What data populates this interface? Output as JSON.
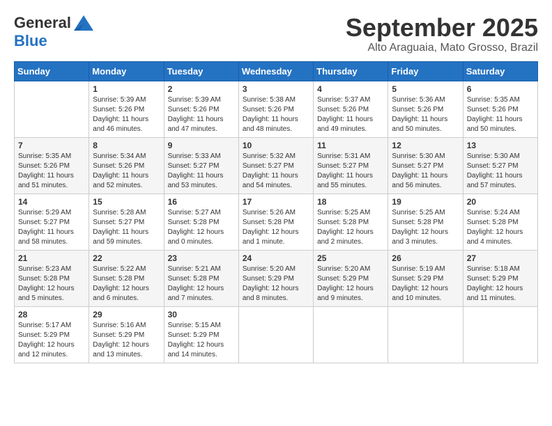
{
  "header": {
    "logo_general": "General",
    "logo_blue": "Blue",
    "month_title": "September 2025",
    "location": "Alto Araguaia, Mato Grosso, Brazil"
  },
  "days_of_week": [
    "Sunday",
    "Monday",
    "Tuesday",
    "Wednesday",
    "Thursday",
    "Friday",
    "Saturday"
  ],
  "weeks": [
    [
      {
        "day": "",
        "info": ""
      },
      {
        "day": "1",
        "info": "Sunrise: 5:39 AM\nSunset: 5:26 PM\nDaylight: 11 hours\nand 46 minutes."
      },
      {
        "day": "2",
        "info": "Sunrise: 5:39 AM\nSunset: 5:26 PM\nDaylight: 11 hours\nand 47 minutes."
      },
      {
        "day": "3",
        "info": "Sunrise: 5:38 AM\nSunset: 5:26 PM\nDaylight: 11 hours\nand 48 minutes."
      },
      {
        "day": "4",
        "info": "Sunrise: 5:37 AM\nSunset: 5:26 PM\nDaylight: 11 hours\nand 49 minutes."
      },
      {
        "day": "5",
        "info": "Sunrise: 5:36 AM\nSunset: 5:26 PM\nDaylight: 11 hours\nand 50 minutes."
      },
      {
        "day": "6",
        "info": "Sunrise: 5:35 AM\nSunset: 5:26 PM\nDaylight: 11 hours\nand 50 minutes."
      }
    ],
    [
      {
        "day": "7",
        "info": "Sunrise: 5:35 AM\nSunset: 5:26 PM\nDaylight: 11 hours\nand 51 minutes."
      },
      {
        "day": "8",
        "info": "Sunrise: 5:34 AM\nSunset: 5:26 PM\nDaylight: 11 hours\nand 52 minutes."
      },
      {
        "day": "9",
        "info": "Sunrise: 5:33 AM\nSunset: 5:27 PM\nDaylight: 11 hours\nand 53 minutes."
      },
      {
        "day": "10",
        "info": "Sunrise: 5:32 AM\nSunset: 5:27 PM\nDaylight: 11 hours\nand 54 minutes."
      },
      {
        "day": "11",
        "info": "Sunrise: 5:31 AM\nSunset: 5:27 PM\nDaylight: 11 hours\nand 55 minutes."
      },
      {
        "day": "12",
        "info": "Sunrise: 5:30 AM\nSunset: 5:27 PM\nDaylight: 11 hours\nand 56 minutes."
      },
      {
        "day": "13",
        "info": "Sunrise: 5:30 AM\nSunset: 5:27 PM\nDaylight: 11 hours\nand 57 minutes."
      }
    ],
    [
      {
        "day": "14",
        "info": "Sunrise: 5:29 AM\nSunset: 5:27 PM\nDaylight: 11 hours\nand 58 minutes."
      },
      {
        "day": "15",
        "info": "Sunrise: 5:28 AM\nSunset: 5:27 PM\nDaylight: 11 hours\nand 59 minutes."
      },
      {
        "day": "16",
        "info": "Sunrise: 5:27 AM\nSunset: 5:28 PM\nDaylight: 12 hours\nand 0 minutes."
      },
      {
        "day": "17",
        "info": "Sunrise: 5:26 AM\nSunset: 5:28 PM\nDaylight: 12 hours\nand 1 minute."
      },
      {
        "day": "18",
        "info": "Sunrise: 5:25 AM\nSunset: 5:28 PM\nDaylight: 12 hours\nand 2 minutes."
      },
      {
        "day": "19",
        "info": "Sunrise: 5:25 AM\nSunset: 5:28 PM\nDaylight: 12 hours\nand 3 minutes."
      },
      {
        "day": "20",
        "info": "Sunrise: 5:24 AM\nSunset: 5:28 PM\nDaylight: 12 hours\nand 4 minutes."
      }
    ],
    [
      {
        "day": "21",
        "info": "Sunrise: 5:23 AM\nSunset: 5:28 PM\nDaylight: 12 hours\nand 5 minutes."
      },
      {
        "day": "22",
        "info": "Sunrise: 5:22 AM\nSunset: 5:28 PM\nDaylight: 12 hours\nand 6 minutes."
      },
      {
        "day": "23",
        "info": "Sunrise: 5:21 AM\nSunset: 5:28 PM\nDaylight: 12 hours\nand 7 minutes."
      },
      {
        "day": "24",
        "info": "Sunrise: 5:20 AM\nSunset: 5:29 PM\nDaylight: 12 hours\nand 8 minutes."
      },
      {
        "day": "25",
        "info": "Sunrise: 5:20 AM\nSunset: 5:29 PM\nDaylight: 12 hours\nand 9 minutes."
      },
      {
        "day": "26",
        "info": "Sunrise: 5:19 AM\nSunset: 5:29 PM\nDaylight: 12 hours\nand 10 minutes."
      },
      {
        "day": "27",
        "info": "Sunrise: 5:18 AM\nSunset: 5:29 PM\nDaylight: 12 hours\nand 11 minutes."
      }
    ],
    [
      {
        "day": "28",
        "info": "Sunrise: 5:17 AM\nSunset: 5:29 PM\nDaylight: 12 hours\nand 12 minutes."
      },
      {
        "day": "29",
        "info": "Sunrise: 5:16 AM\nSunset: 5:29 PM\nDaylight: 12 hours\nand 13 minutes."
      },
      {
        "day": "30",
        "info": "Sunrise: 5:15 AM\nSunset: 5:29 PM\nDaylight: 12 hours\nand 14 minutes."
      },
      {
        "day": "",
        "info": ""
      },
      {
        "day": "",
        "info": ""
      },
      {
        "day": "",
        "info": ""
      },
      {
        "day": "",
        "info": ""
      }
    ]
  ]
}
